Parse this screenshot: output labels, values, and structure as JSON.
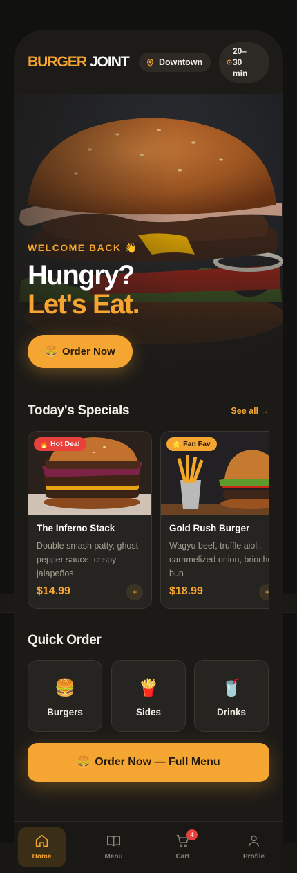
{
  "brand": {
    "part1": "BURGER",
    "part2": "JOINT"
  },
  "location": {
    "label": "Downtown"
  },
  "delivery_time": {
    "label": "20–30 min"
  },
  "hero": {
    "welcome": "WELCOME BACK 👋",
    "headline_line1": "Hungry?",
    "headline_line2": "Let's Eat.",
    "cta_icon": "🍔",
    "cta_label": "Order Now"
  },
  "specials": {
    "title": "Today's Specials",
    "see_all": "See all →",
    "items": [
      {
        "badge_icon": "🔥",
        "badge": "Hot Deal",
        "name": "The Inferno Stack",
        "description": "Double smash patty, ghost pepper sauce, crispy jalapeños",
        "price": "$14.99",
        "add": "+"
      },
      {
        "badge_icon": "⭐",
        "badge": "Fan Fav",
        "name": "Gold Rush Burger",
        "description": "Wagyu beef, truffle aioli, caramelized onion, brioche bun",
        "price": "$18.99",
        "add": "+"
      }
    ]
  },
  "quick_order": {
    "title": "Quick Order",
    "items": [
      {
        "icon": "🍔",
        "label": "Burgers"
      },
      {
        "icon": "🍟",
        "label": "Sides"
      },
      {
        "icon": "🥤",
        "label": "Drinks"
      }
    ]
  },
  "full_menu_button": {
    "icon": "🍔",
    "label": "Order Now — Full Menu"
  },
  "nav": {
    "items": [
      {
        "icon": "home-icon",
        "label": "Home",
        "active": true
      },
      {
        "icon": "book-icon",
        "label": "Menu",
        "active": false
      },
      {
        "icon": "cart-icon",
        "label": "Cart",
        "active": false,
        "badge": "4"
      },
      {
        "icon": "user-icon",
        "label": "Profile",
        "active": false
      }
    ]
  },
  "colors": {
    "accent": "#f5a531",
    "background": "#1c1a17",
    "card": "#262420",
    "badge_hot": "#e8403b"
  }
}
